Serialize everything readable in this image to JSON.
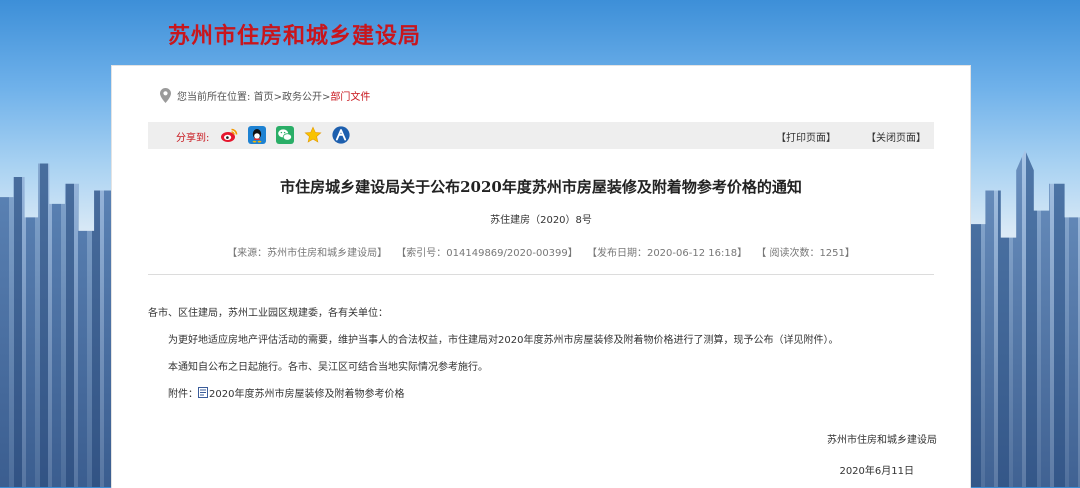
{
  "site": {
    "title": "苏州市住房和城乡建设局"
  },
  "location": {
    "label": "您当前所在位置:",
    "home": "首页",
    "sep1": ">",
    "section": "政务公开",
    "sep2": ">",
    "current": "部门文件"
  },
  "share": {
    "label": "分享到:",
    "icons": [
      "weibo-icon",
      "qq-icon",
      "wechat-icon",
      "qzone-star-icon",
      "renren-icon"
    ]
  },
  "toolbar": {
    "print": "【打印页面】",
    "close": "【关闭页面】"
  },
  "document": {
    "title": "市住房城乡建设局关于公布2020年度苏州市房屋装修及附着物参考价格的通知",
    "number": "苏住建房（2020）8号",
    "meta": {
      "source": "【来源：苏州市住房和城乡建设局】",
      "index": "【索引号：014149869/2020-00399】",
      "date": "【发布日期：2020-06-12 16:18】",
      "views": "【 阅读次数：1251】"
    },
    "salutation": "各市、区住建局，苏州工业园区规建委，各有关单位：",
    "para1": "为更好地适应房地产评估活动的需要，维护当事人的合法权益，市住建局对2020年度苏州市房屋装修及附着物价格进行了测算，现予公布（详见附件）。",
    "para2": "本通知自公布之日起施行。各市、吴江区可结合当地实际情况参考施行。",
    "attachment_label": "附件：",
    "attachment_link": "2020年度苏州市房屋装修及附着物参考价格",
    "signature": "苏州市住房和城乡建设局",
    "sign_date": "2020年6月11日"
  },
  "colors": {
    "accent": "#c8161d",
    "share_bar": "#eeeeee",
    "panel": "#ffffff"
  }
}
